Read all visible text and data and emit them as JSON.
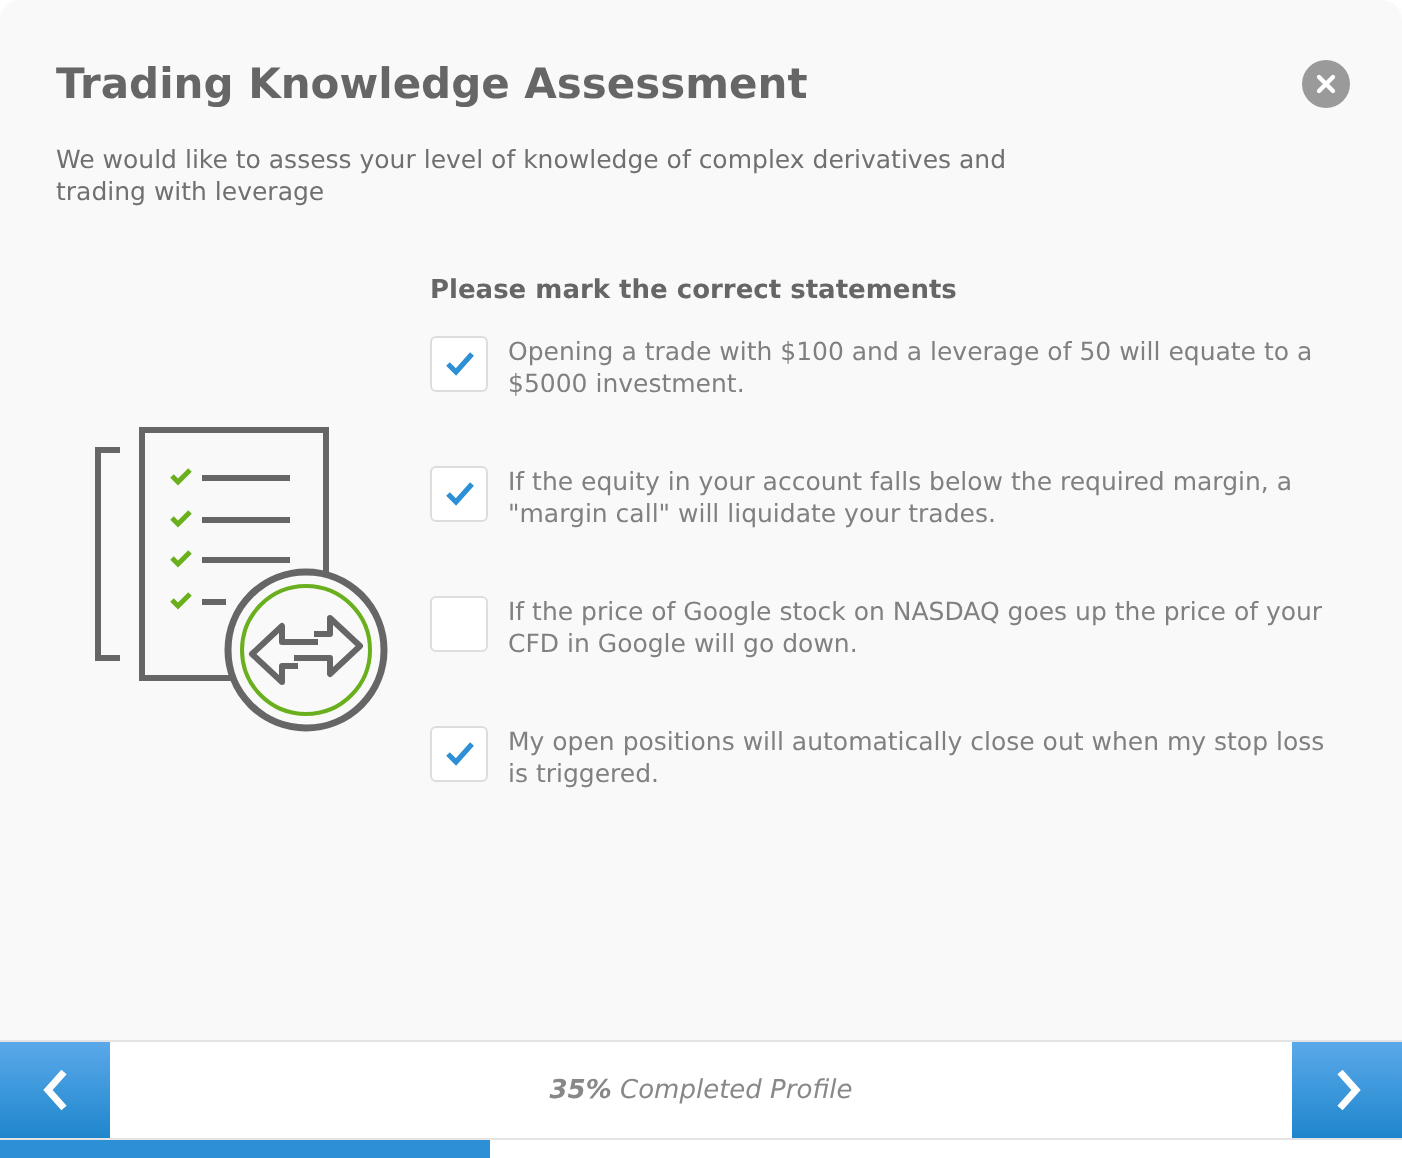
{
  "title": "Trading Knowledge Assessment",
  "subtitle": "We would like to assess your level of knowledge of complex derivatives and trading with leverage",
  "question": "Please mark the correct statements",
  "statements": [
    {
      "text": "Opening a trade with $100 and a leverage of 50 will equate to a $5000 investment.",
      "checked": true
    },
    {
      "text": "If the equity in your account falls below the required margin, a \"margin call\" will liquidate your trades.",
      "checked": true
    },
    {
      "text": "If the price of Google stock on NASDAQ goes up the price of your CFD in Google will go down.",
      "checked": false
    },
    {
      "text": "My open positions will automatically close out when my stop loss is triggered.",
      "checked": true
    }
  ],
  "footer": {
    "progress_text": "**35%** Completed Profile",
    "level": 0.35
  }
}
